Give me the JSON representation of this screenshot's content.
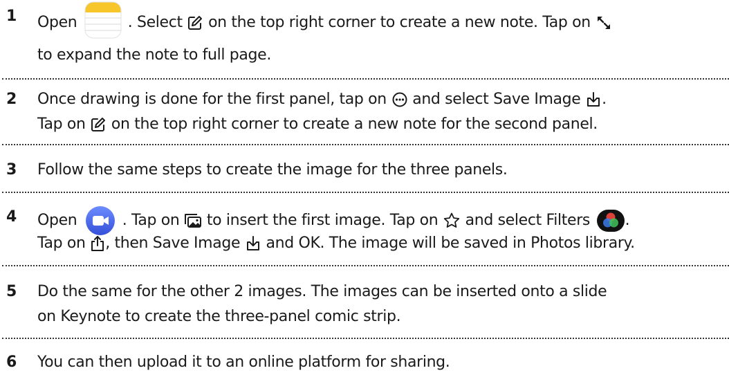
{
  "steps": [
    {
      "number": "1",
      "l1a": "Open",
      "l1b": ". Select",
      "l1c": "on the top right corner to create a new note. Tap on",
      "l2": "to expand the note to full page."
    },
    {
      "number": "2",
      "l1a": "Once drawing is done for the first panel, tap on",
      "l1b": "and select Save Image",
      "l1c": ".",
      "l2a": "Tap on",
      "l2b": "on the top right corner to create a new note for the second panel."
    },
    {
      "number": "3",
      "l1": "Follow the same steps to create the image for the three panels."
    },
    {
      "number": "4",
      "l1a": "Open",
      "l1b": ". Tap on",
      "l1c": "to insert the first image. Tap on",
      "l1d": "and select Filters",
      "l1e": ".",
      "l2a": "Tap on",
      "l2b": ", then Save Image",
      "l2c": "and OK. The image will be saved in Photos library."
    },
    {
      "number": "5",
      "l1": "Do the same for the other 2 images. The images can be inserted onto a slide",
      "l2": "on Keynote to create the three-panel comic strip."
    },
    {
      "number": "6",
      "l1": "You can then upload it to an online platform for sharing."
    }
  ],
  "icons": {
    "notes_app": "notes-app-icon",
    "compose": "compose-icon",
    "expand": "expand-icon",
    "more": "more-icon",
    "save_image": "save-image-icon",
    "clips_app": "clips-app-icon",
    "photo_library": "photo-library-icon",
    "effects_star": "star-icon",
    "filters": "filters-icon",
    "share": "share-icon"
  },
  "colors": {
    "notes_yellow": "#F7C62B",
    "clips_blue": "#4A6EEA",
    "text": "#1a1a1a"
  }
}
